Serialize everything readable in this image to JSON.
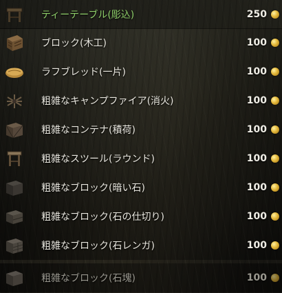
{
  "shop": {
    "items": [
      {
        "name": "ティーテーブル(彫込)",
        "price": "250",
        "icon": "table-icon"
      },
      {
        "name": "ブロック(木工)",
        "price": "100",
        "icon": "wood-block-icon"
      },
      {
        "name": "ラフブレッド(一片)",
        "price": "100",
        "icon": "bread-icon"
      },
      {
        "name": "粗雑なキャンプファイア(消火)",
        "price": "100",
        "icon": "campfire-icon"
      },
      {
        "name": "粗雑なコンテナ(積荷)",
        "price": "100",
        "icon": "crate-icon"
      },
      {
        "name": "粗雑なスツール(ラウンド)",
        "price": "100",
        "icon": "stool-icon"
      },
      {
        "name": "粗雑なブロック(暗い石)",
        "price": "100",
        "icon": "dark-stone-block-icon"
      },
      {
        "name": "粗雑なブロック(石の仕切り)",
        "price": "100",
        "icon": "stone-divider-block-icon"
      },
      {
        "name": "粗雑なブロック(石レンガ)",
        "price": "100",
        "icon": "stone-brick-block-icon"
      },
      {
        "name": "粗雑なブロック(石塊)",
        "price": "100",
        "icon": "stone-lump-block-icon"
      }
    ],
    "currency_icon": "gold-coin-icon",
    "colors": {
      "selected_text": "#8fcf6a",
      "text": "#e9e7df",
      "dim_text": "#9a988f",
      "coin": "#e3b73a"
    }
  }
}
